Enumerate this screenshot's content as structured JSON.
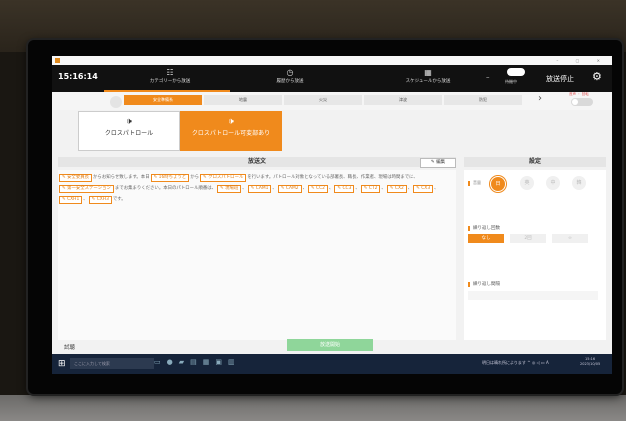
{
  "window": {
    "title": ""
  },
  "header": {
    "clock": "15:16:14",
    "nav": [
      {
        "icon": "grid-icon",
        "glyph": "☷",
        "label": "カテゴリーから放送"
      },
      {
        "icon": "clock-icon",
        "glyph": "◷",
        "label": "履歴から放送"
      },
      {
        "icon": "calendar-icon",
        "glyph": "▦",
        "label": "スケジュールから放送"
      }
    ],
    "status_label": "待機中",
    "stop_label": "放送停止"
  },
  "categories": {
    "tabs": [
      "安全準備系",
      "地震",
      "火災",
      "津波",
      "防犯"
    ],
    "active_index": 0,
    "toggle_label": "音声 ・ 回転"
  },
  "subcategories": [
    {
      "label": "クロスパトロール",
      "selected": false
    },
    {
      "label": "クロスパトロール可変部あり",
      "selected": true
    }
  ],
  "broadcast": {
    "header": "放送文",
    "edit_label": "編集",
    "segments": [
      {
        "chip": "安全委員長"
      },
      {
        "text": "からお知らせ致します。本日"
      },
      {
        "chip": "16時ちょうど"
      },
      {
        "text": "から"
      },
      {
        "chip": "クロスパトロール"
      },
      {
        "text": "を行います。パトロール対象となっている部署長、職長、作業者、現場は時間までに、"
      },
      {
        "chip": "第一安全ステーション"
      },
      {
        "text": "までお集まりください。本日のパトロール順番は、"
      },
      {
        "chip": "現場班"
      },
      {
        "text": "、"
      },
      {
        "chip": "CAM1"
      },
      {
        "text": "、"
      },
      {
        "chip": "CAM2"
      },
      {
        "text": "、"
      },
      {
        "chip": "CC2"
      },
      {
        "text": "、"
      },
      {
        "chip": "CC3"
      },
      {
        "text": "、"
      },
      {
        "chip": "CT2"
      },
      {
        "text": "、"
      },
      {
        "chip": "CX2"
      },
      {
        "text": "、"
      },
      {
        "chip": "CX3"
      },
      {
        "text": "、"
      },
      {
        "chip": "CXH1"
      },
      {
        "text": "、"
      },
      {
        "chip": "CXH3"
      },
      {
        "text": "です。"
      }
    ]
  },
  "settings": {
    "header": "設定",
    "volume_label": "音量",
    "volume_options": [
      "日",
      "英",
      "中",
      "韓"
    ],
    "volume_selected": 0,
    "repeat_label": "繰り返し回数",
    "repeat_options": [
      "なし",
      "2回",
      "∞"
    ],
    "repeat_selected": 0,
    "interval_label": "繰り返し間隔"
  },
  "footer": {
    "trial_label": "試聴",
    "start_label": "放送開始"
  },
  "taskbar": {
    "search_placeholder": "ここに入力して検索",
    "tray_text": "明日は晴れ所によります ^ ◎ ◁ ▭ A",
    "time": "15:16",
    "date": "2023/10/05"
  },
  "colors": {
    "accent": "#f08a1c",
    "header": "#111111",
    "start_button": "#8fd69a"
  }
}
